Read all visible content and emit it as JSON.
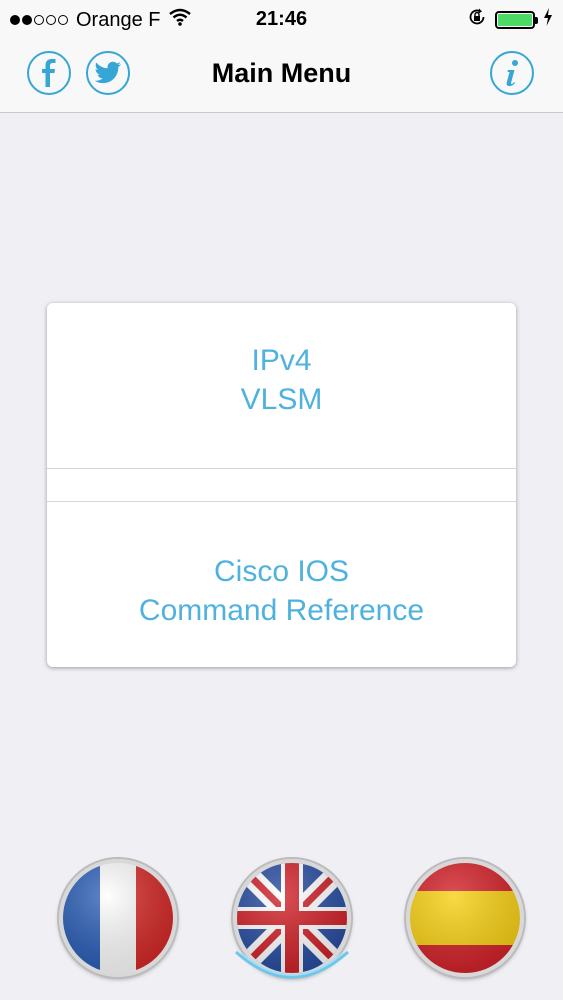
{
  "status_bar": {
    "carrier": "Orange F",
    "time": "21:46",
    "signal_dots_filled": 2,
    "signal_dots_total": 5,
    "battery_color": "#4cd964"
  },
  "nav_bar": {
    "title": "Main Menu",
    "left_icons": [
      "facebook-icon",
      "twitter-icon"
    ],
    "right_icon": "info-icon",
    "accent_color": "#36a6d6"
  },
  "menu": {
    "items": [
      {
        "line1": "IPv4",
        "line2": "VLSM"
      },
      {
        "line1": "Cisco IOS",
        "line2": "Command Reference"
      }
    ],
    "text_color": "#4fb2de"
  },
  "languages": {
    "items": [
      "flag-france",
      "flag-united-kingdom",
      "flag-spain"
    ],
    "selected": "flag-united-kingdom"
  }
}
